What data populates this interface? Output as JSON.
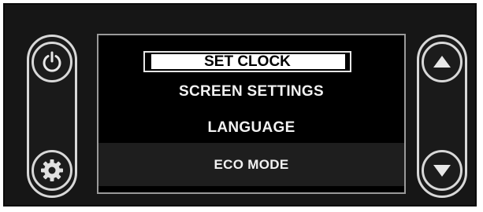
{
  "menu": {
    "items": [
      {
        "label": "SET CLOCK",
        "selected": true
      },
      {
        "label": "SCREEN SETTINGS",
        "selected": false
      },
      {
        "label": "LANGUAGE",
        "selected": false
      },
      {
        "label": "ECO MODE",
        "selected": false
      }
    ]
  },
  "controls": {
    "left": [
      {
        "icon": "power-icon"
      },
      {
        "icon": "gear-icon"
      }
    ],
    "right": [
      {
        "icon": "arrow-up-icon"
      },
      {
        "icon": "arrow-down-icon"
      }
    ]
  },
  "colors": {
    "panel": "#161616",
    "screen": "#000000",
    "text": "#f2f2f2",
    "highlight": "#ffffff",
    "outline": "#d8d8d8"
  }
}
